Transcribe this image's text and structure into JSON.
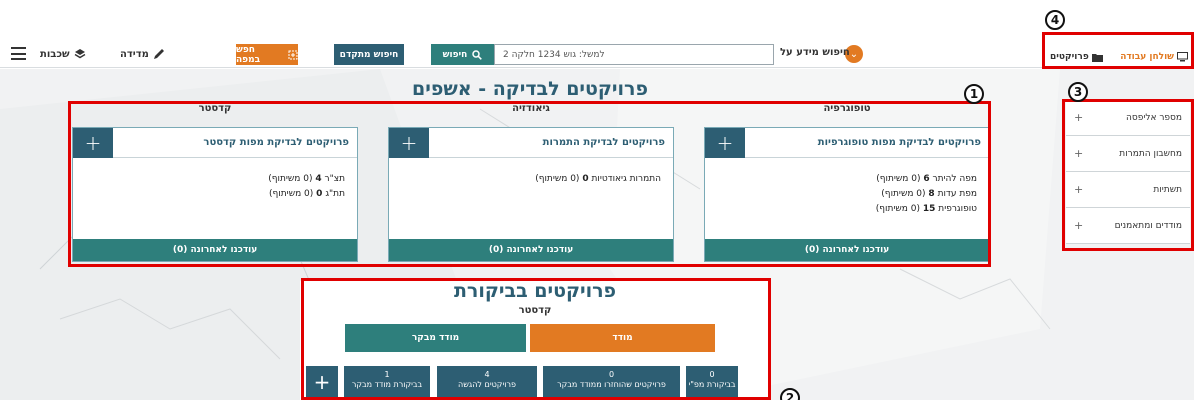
{
  "header": {
    "workspace_tab": "שולחן עבודה",
    "projects_tab": "פרויקטים",
    "search_on_label": "חיפוש מידע על",
    "search_placeholder": "למשל: גוש 1234 חלקה 2",
    "search_button": "חיפוש",
    "advanced_search_button": "חיפוש מתקדם",
    "map_search_button": "חפש במפה",
    "measure_label": "מדידה",
    "layers_label": "שכבות"
  },
  "sidebar": {
    "items": [
      {
        "label": "מספר אליפסה",
        "plus": "+"
      },
      {
        "label": "מחשבון התמרות",
        "plus": "+"
      },
      {
        "label": "תשתיות",
        "plus": "+"
      },
      {
        "label": "מודדים ומתאמנים",
        "plus": "+"
      }
    ]
  },
  "main": {
    "title": "פרויקטים לבדיקה - אשפים",
    "columns": [
      {
        "heading": "טופוגרפיה",
        "card_title": "פרויקטים לבדיקת מפות טופוגרפיות",
        "lines": [
          {
            "text": "מפה להיתר",
            "count": "6",
            "shared": "(0 משיתוף)"
          },
          {
            "text": "מפת עדות",
            "count": "8",
            "shared": "(0 משיתוף)"
          },
          {
            "text": "טופוגרפית",
            "count": "15",
            "shared": "(0 משיתוף)"
          }
        ],
        "footer": "עודכנו לאחרונה (0)"
      },
      {
        "heading": "גיאודזיה",
        "card_title": "פרויקטים לבדיקת התמרות",
        "lines": [
          {
            "text": "התמרות גיאודטיות",
            "count": "0",
            "shared": "(0 משיתוף)"
          }
        ],
        "footer": "עודכנו לאחרונה (0)"
      },
      {
        "heading": "קדסטר",
        "card_title": "פרויקטים לבדיקת מפות קדסטר",
        "lines": [
          {
            "text": "תצ\"ר",
            "count": "4",
            "shared": "(0 משיתוף)"
          },
          {
            "text": "תת\"ג",
            "count": "0",
            "shared": "(0 משיתוף)"
          }
        ],
        "footer": "עודכנו לאחרונה (0)"
      }
    ],
    "plus": "+"
  },
  "review": {
    "title": "פרויקטים בביקורת",
    "subtitle": "קדסטר",
    "tab_surveyor": "מודד",
    "tab_reviewer": "מודד מבקר",
    "stats": [
      {
        "count": "0",
        "label": "בביקורת מפ\"י"
      },
      {
        "count": "0",
        "label": "פרויקטים שהוחזרו ממודד מבקר"
      },
      {
        "count": "4",
        "label": "פרויקטים להגשה"
      },
      {
        "count": "1",
        "label": "בביקורת מודד מבקר"
      }
    ]
  },
  "callouts": [
    "1",
    "2",
    "3",
    "4"
  ],
  "colors": {
    "teal": "#2e7f7c",
    "dark_blue": "#2d5e73",
    "orange": "#e27a22",
    "callout_red": "#e00000"
  }
}
